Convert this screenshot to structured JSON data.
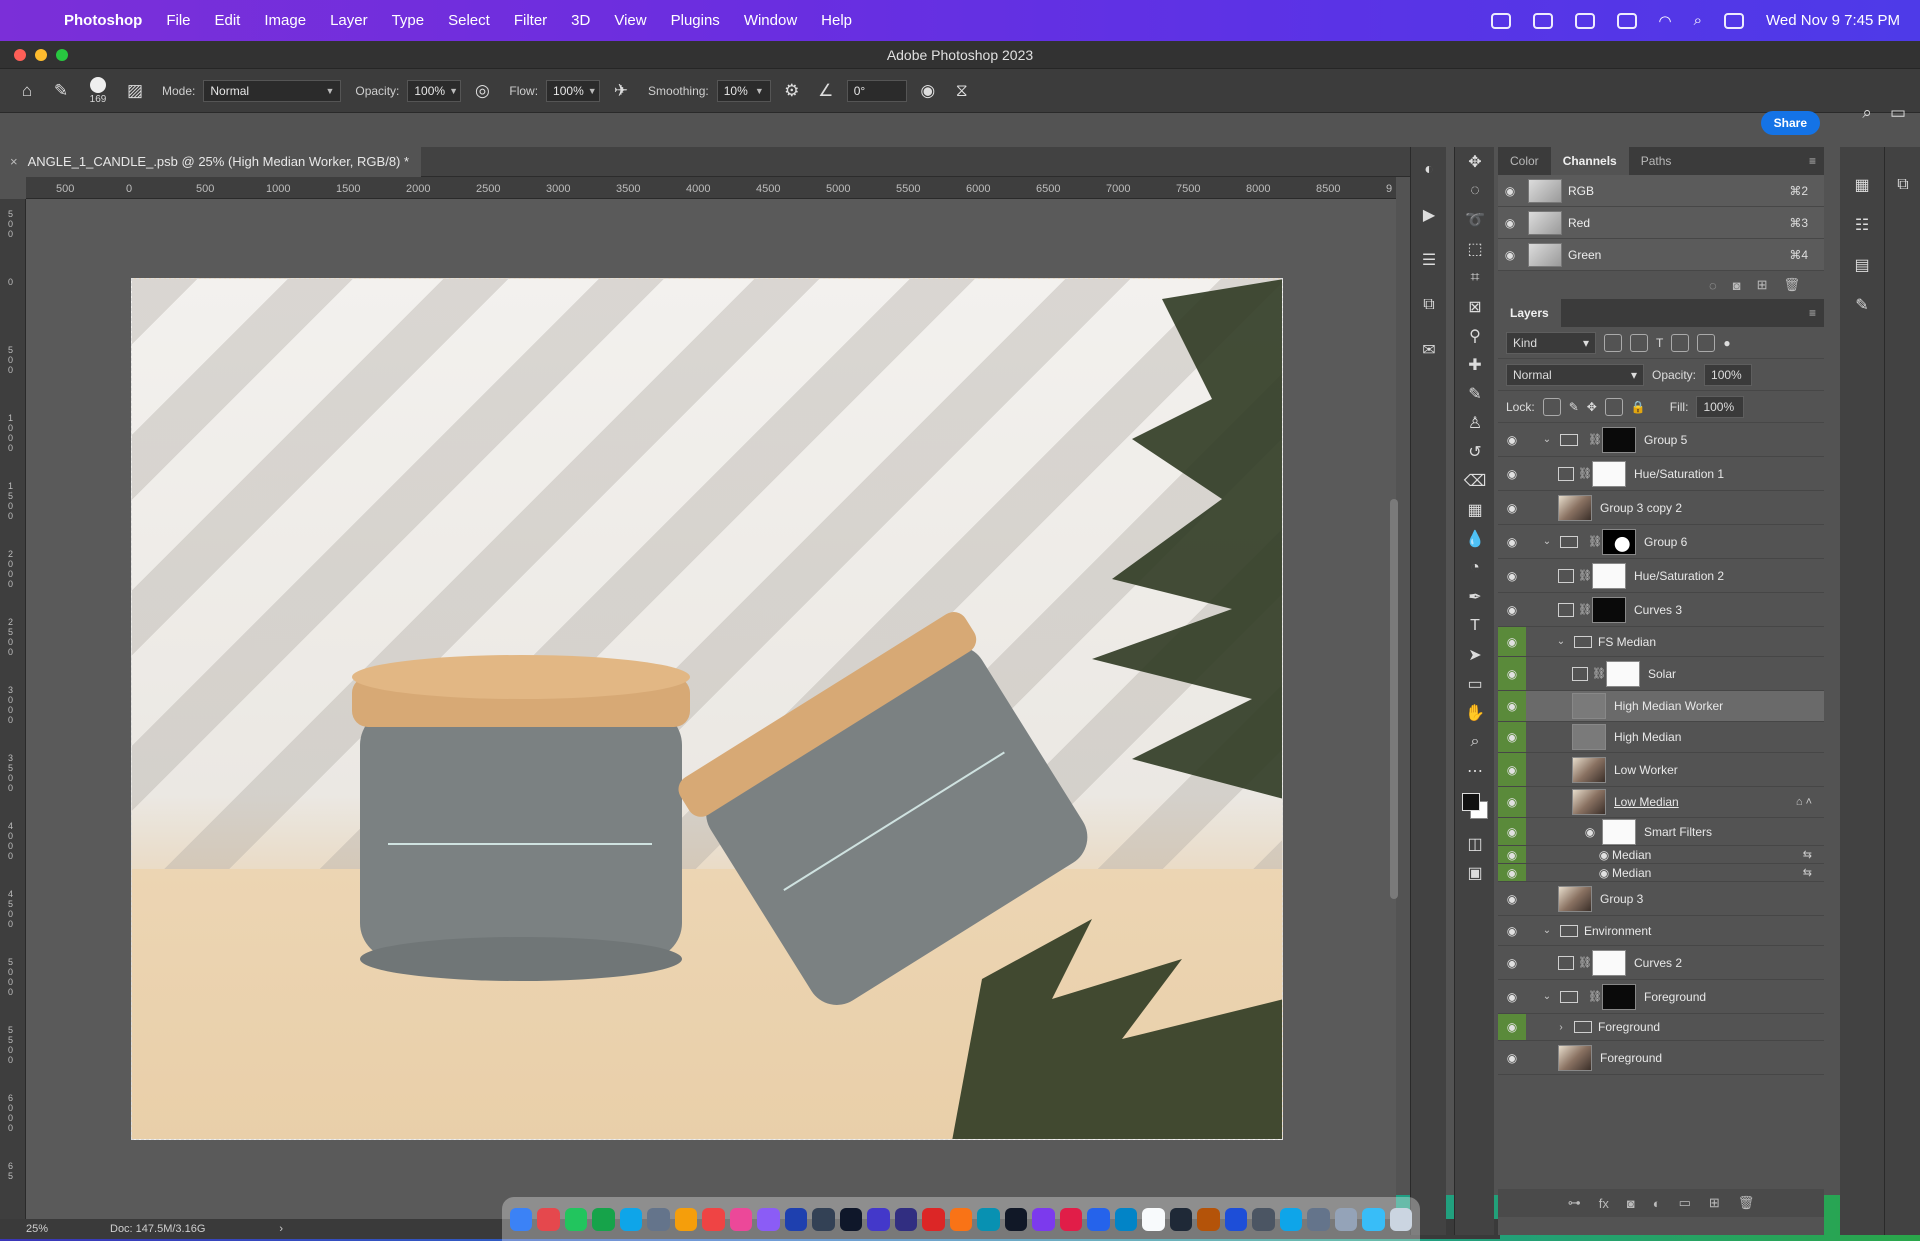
{
  "menubar": {
    "app_name": "Photoshop",
    "items": [
      "File",
      "Edit",
      "Image",
      "Layer",
      "Type",
      "Select",
      "Filter",
      "3D",
      "View",
      "Plugins",
      "Window",
      "Help"
    ],
    "datetime": "Wed Nov 9  7:45 PM"
  },
  "window": {
    "title": "Adobe Photoshop 2023"
  },
  "options": {
    "brush_size": "169",
    "mode_label": "Mode:",
    "mode_value": "Normal",
    "opacity_label": "Opacity:",
    "opacity_value": "100%",
    "flow_label": "Flow:",
    "flow_value": "100%",
    "smoothing_label": "Smoothing:",
    "smoothing_value": "10%",
    "angle_value": "0°",
    "share_label": "Share"
  },
  "document": {
    "tab_title": "ANGLE_1_CANDLE_.psb @ 25% (High Median Worker, RGB/8) *",
    "ruler_h": [
      "500",
      "0",
      "500",
      "1000",
      "1500",
      "2000",
      "2500",
      "3000",
      "3500",
      "4000",
      "4500",
      "5000",
      "5500",
      "6000",
      "6500",
      "7000",
      "7500",
      "8000",
      "8500",
      "9"
    ],
    "ruler_v": [
      "500",
      "0",
      "500",
      "1000",
      "1500",
      "2000",
      "2500",
      "3000",
      "3500",
      "4000",
      "4500",
      "5000",
      "5500",
      "6000",
      "65"
    ],
    "zoom": "25%",
    "doc_info": "Doc: 147.5M/3.16G"
  },
  "channels_panel": {
    "tabs": [
      "Color",
      "Channels",
      "Paths"
    ],
    "active_tab": "Channels",
    "rows": [
      {
        "name": "RGB",
        "shortcut": "⌘2"
      },
      {
        "name": "Red",
        "shortcut": "⌘3"
      },
      {
        "name": "Green",
        "shortcut": "⌘4"
      }
    ]
  },
  "layers_panel": {
    "title": "Layers",
    "filter_kind": "Kind",
    "blend_mode": "Normal",
    "opacity_label": "Opacity:",
    "opacity_value": "100%",
    "lock_label": "Lock:",
    "fill_label": "Fill:",
    "fill_value": "100%",
    "layers": [
      {
        "name": "Group 5",
        "kind": "group",
        "indent": 1,
        "thumb": "black"
      },
      {
        "name": "Hue/Saturation 1",
        "kind": "adjustment",
        "indent": 2,
        "thumb": "white"
      },
      {
        "name": "Group 3 copy 2",
        "kind": "photo",
        "indent": 2,
        "thumb": "photo"
      },
      {
        "name": "Group 6",
        "kind": "group",
        "indent": 1,
        "thumb": "mask"
      },
      {
        "name": "Hue/Saturation 2",
        "kind": "adjustment",
        "indent": 2,
        "thumb": "white"
      },
      {
        "name": "Curves 3",
        "kind": "adjustment",
        "indent": 2,
        "thumb": "black"
      },
      {
        "name": "FS Median",
        "kind": "folder",
        "indent": 2,
        "green": true
      },
      {
        "name": "Solar",
        "kind": "adjustment",
        "indent": 3,
        "thumb": "white",
        "green": true
      },
      {
        "name": "High Median Worker",
        "kind": "layer",
        "indent": 3,
        "thumb": "gray",
        "green": true,
        "selected": true
      },
      {
        "name": "High Median",
        "kind": "layer",
        "indent": 3,
        "thumb": "gray",
        "green": true
      },
      {
        "name": "Low Worker",
        "kind": "photo",
        "indent": 3,
        "thumb": "photo",
        "green": true
      },
      {
        "name": "Low Median",
        "kind": "smart",
        "indent": 3,
        "thumb": "photo",
        "green": true,
        "underline": true
      },
      {
        "name": "Smart Filters",
        "kind": "smartfilters",
        "indent": 4,
        "thumb": "white",
        "green": true
      },
      {
        "name": "Median",
        "kind": "filter",
        "indent": 5,
        "green": true
      },
      {
        "name": "Median",
        "kind": "filter",
        "indent": 5,
        "green": true
      },
      {
        "name": "Group 3",
        "kind": "photo",
        "indent": 2,
        "thumb": "photo"
      },
      {
        "name": "Environment",
        "kind": "folder",
        "indent": 1
      },
      {
        "name": "Curves 2",
        "kind": "adjustment",
        "indent": 2,
        "thumb": "white"
      },
      {
        "name": "Foreground",
        "kind": "group",
        "indent": 1,
        "thumb": "black"
      },
      {
        "name": "Foreground",
        "kind": "folder-closed",
        "indent": 2,
        "green": true
      },
      {
        "name": "Foreground",
        "kind": "photo",
        "indent": 2,
        "thumb": "photo"
      }
    ]
  },
  "colors": {
    "accent": "#1473e6",
    "visibility_green": "#5a8a3a",
    "panel_bg": "#535353"
  }
}
